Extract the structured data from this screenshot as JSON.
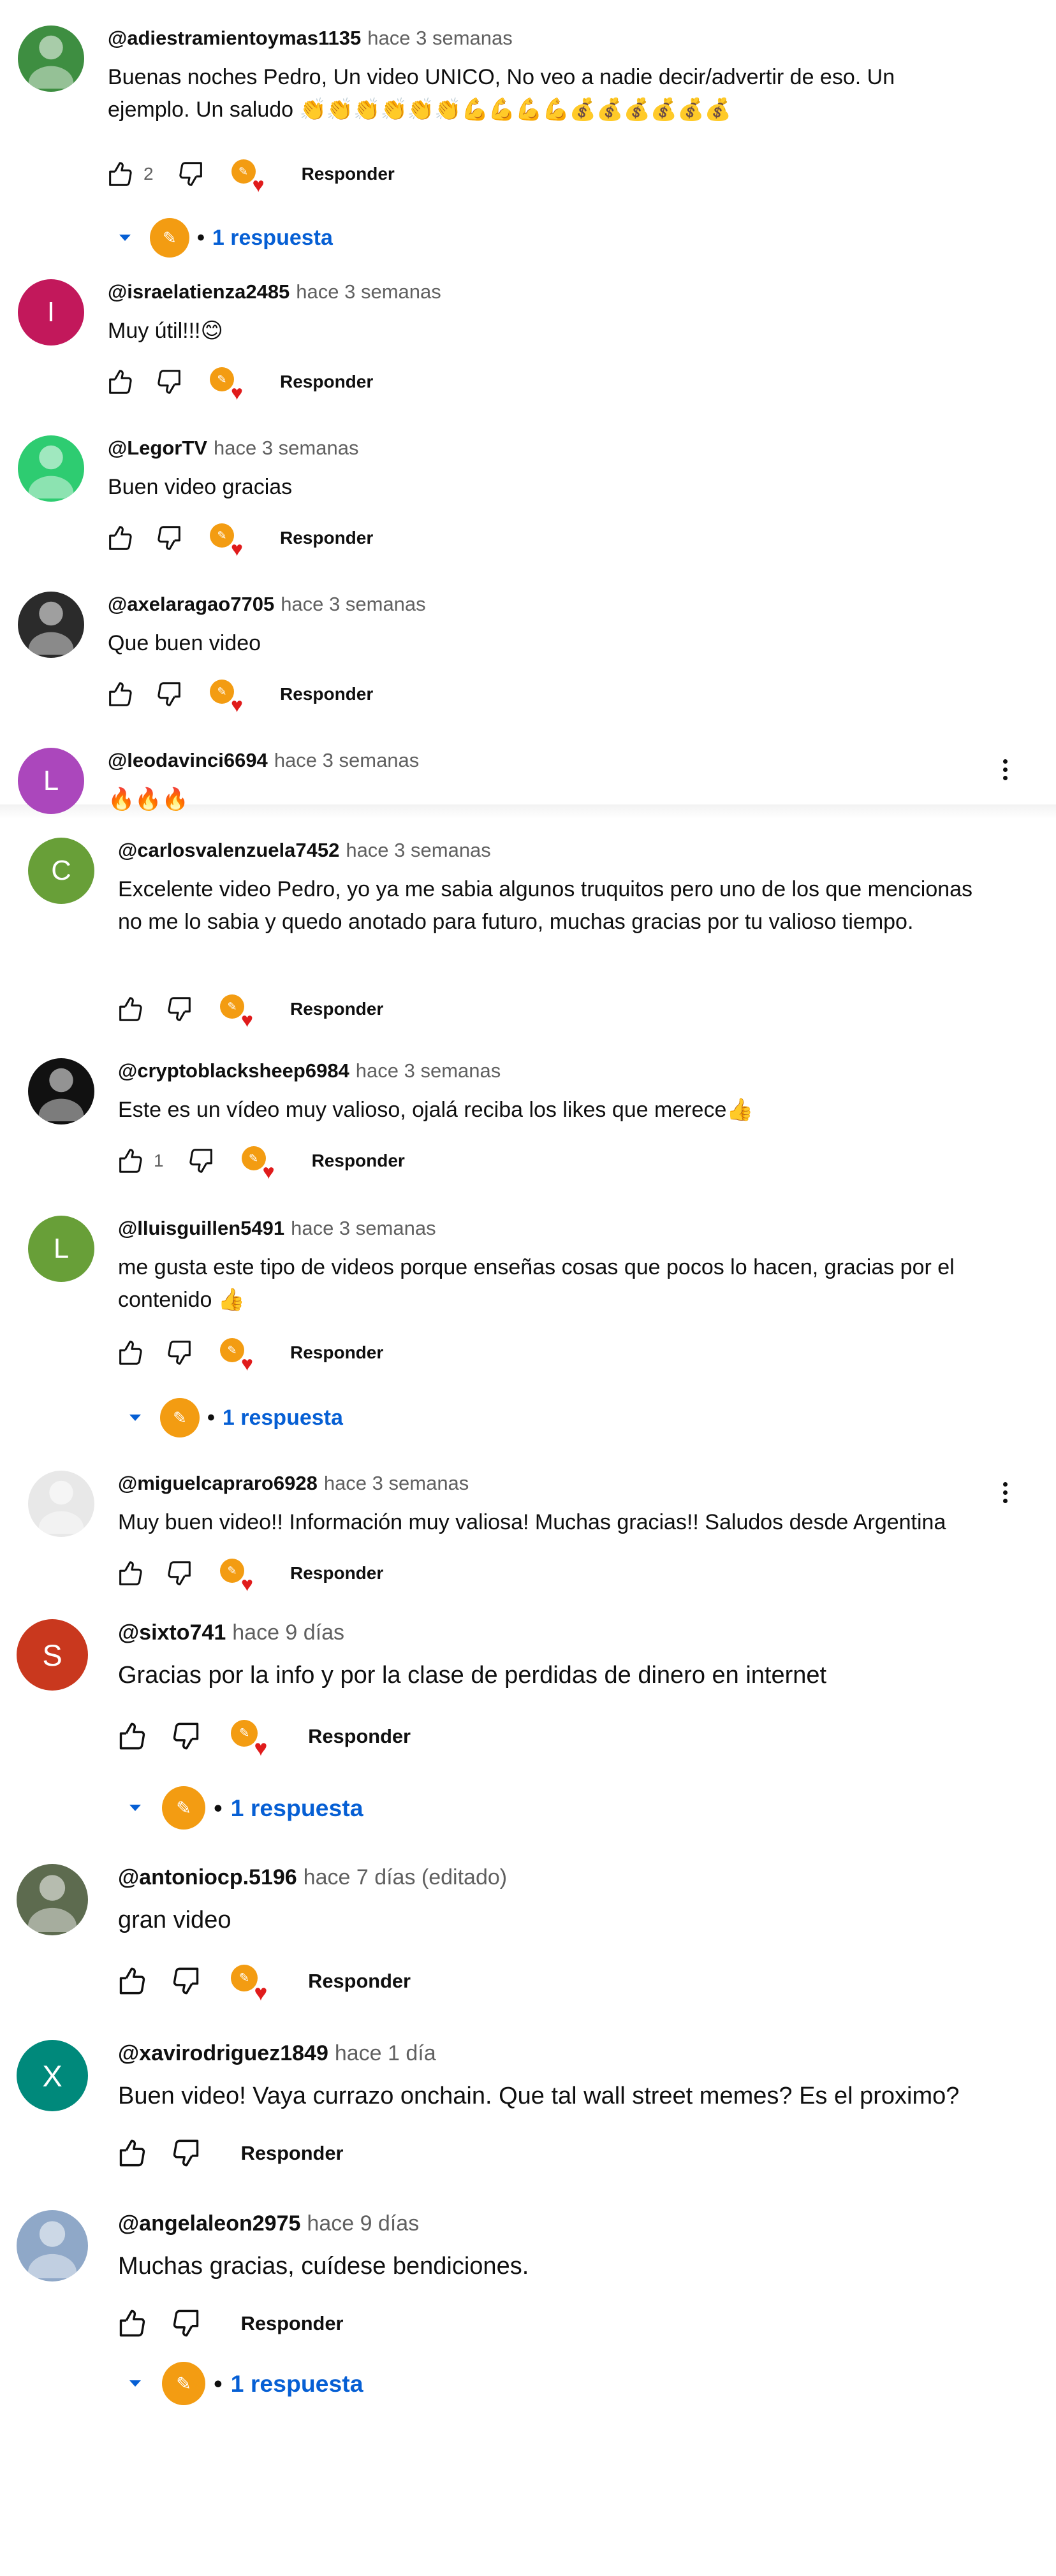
{
  "reply_label": "Responder",
  "replies_label": "1 respuesta",
  "colors": {
    "accent": "#065fd4",
    "heart": "#e01b1b",
    "creator": "#f39c12"
  },
  "comments": [
    {
      "author": "@adiestramientoymas1135",
      "time": "hace 3 semanas",
      "text": "Buenas noches Pedro, Un video UNICO,  No veo a nadie decir/advertir de eso. Un ejemplo. Un saludo 👏👏👏👏👏👏💪💪💪💪💰💰💰💰💰💰",
      "likes": "2",
      "avatar_letter": "",
      "avatar_color": "#3e8e41",
      "hearted": true,
      "replies": true
    },
    {
      "author": "@israelatienza2485",
      "time": "hace 3 semanas",
      "text": "Muy útil!!!😊",
      "likes": "",
      "avatar_letter": "I",
      "avatar_color": "#c2185b",
      "hearted": true,
      "replies": false
    },
    {
      "author": "@LegorTV",
      "time": "hace 3 semanas",
      "text": "Buen video gracias",
      "likes": "",
      "avatar_letter": "",
      "avatar_color": "#2ecc71",
      "hearted": true,
      "replies": false
    },
    {
      "author": "@axelaragao7705",
      "time": "hace 3 semanas",
      "text": "Que buen video",
      "likes": "",
      "avatar_letter": "",
      "avatar_color": "#2b2b2b",
      "hearted": true,
      "replies": false
    },
    {
      "author": "@leodavinci6694",
      "time": "hace 3 semanas",
      "text": "🔥🔥🔥",
      "likes": "",
      "avatar_letter": "L",
      "avatar_color": "#ab47bc",
      "hearted": false,
      "replies": false
    },
    {
      "author": "@carlosvalenzuela7452",
      "time": "hace 3 semanas",
      "text": "Excelente video Pedro, yo ya me sabia algunos truquitos pero uno de los que mencionas no me lo sabia y quedo anotado para futuro, muchas gracias por tu valioso tiempo.",
      "likes": "",
      "avatar_letter": "C",
      "avatar_color": "#689f38",
      "hearted": true,
      "replies": false
    },
    {
      "author": "@cryptoblacksheep6984",
      "time": "hace 3 semanas",
      "text": "Este es un vídeo muy valioso, ojalá reciba los likes que merece👍",
      "likes": "1",
      "avatar_letter": "",
      "avatar_color": "#111111",
      "hearted": true,
      "replies": false
    },
    {
      "author": "@lluisguillen5491",
      "time": "hace 3 semanas",
      "text": "me gusta este tipo de videos porque enseñas cosas que pocos lo hacen, gracias por el contenido 👍",
      "likes": "",
      "avatar_letter": "L",
      "avatar_color": "#689f38",
      "hearted": true,
      "replies": true
    },
    {
      "author": "@miguelcapraro6928",
      "time": "hace 3 semanas",
      "text": "Muy buen video!! Información muy valiosa! Muchas gracias!! Saludos desde Argentina",
      "likes": "",
      "avatar_letter": "",
      "avatar_color": "#e8e8e8",
      "hearted": true,
      "replies": false
    },
    {
      "author": "@sixto741",
      "time": "hace 9 días",
      "text": "Gracias por la info y por la clase de perdidas de dinero en internet",
      "likes": "",
      "avatar_letter": "S",
      "avatar_color": "#c9381e",
      "hearted": true,
      "replies": true
    },
    {
      "author": "@antoniocp.5196",
      "time": "hace 7 días (editado)",
      "text": "gran video",
      "likes": "",
      "avatar_letter": "",
      "avatar_color": "#5d6b4f",
      "hearted": true,
      "replies": false
    },
    {
      "author": "@xavirodriguez1849",
      "time": "hace 1 día",
      "text": "Buen video! Vaya currazo onchain. Que tal wall street memes? Es el proximo?",
      "likes": "",
      "avatar_letter": "X",
      "avatar_color": "#00897b",
      "hearted": false,
      "replies": false
    },
    {
      "author": "@angelaleon2975",
      "time": "hace 9 días",
      "text": "Muchas gracias, cuídese bendiciones.",
      "likes": "",
      "avatar_letter": "",
      "avatar_color": "#8fa8c8",
      "hearted": false,
      "replies": true
    }
  ]
}
